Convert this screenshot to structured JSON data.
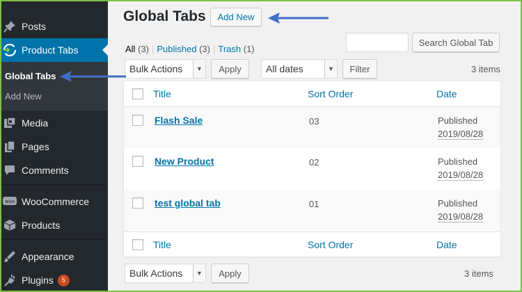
{
  "sidebar": {
    "items": [
      {
        "label": "Posts",
        "icon": "pin-icon"
      },
      {
        "label": "Product Tabs",
        "icon": "product-tabs-icon",
        "active": true
      },
      {
        "label": "Media",
        "icon": "media-icon"
      },
      {
        "label": "Pages",
        "icon": "pages-icon"
      },
      {
        "label": "Comments",
        "icon": "comments-icon"
      },
      {
        "label": "WooCommerce",
        "icon": "woocommerce-icon"
      },
      {
        "label": "Products",
        "icon": "products-icon"
      },
      {
        "label": "Appearance",
        "icon": "appearance-icon"
      },
      {
        "label": "Plugins",
        "icon": "plugins-icon",
        "badge": "5"
      }
    ],
    "submenu": [
      {
        "label": "Global Tabs",
        "current": true
      },
      {
        "label": "Add New"
      }
    ]
  },
  "header": {
    "title": "Global Tabs",
    "add_new_label": "Add New"
  },
  "filters": {
    "all_label": "All",
    "all_count": "(3)",
    "published_label": "Published",
    "published_count": "(3)",
    "trash_label": "Trash",
    "trash_count": "(1)",
    "separator": "|"
  },
  "search": {
    "value": "",
    "button_label": "Search Global Tab"
  },
  "tablenav_top": {
    "bulk_actions": "Bulk Actions",
    "apply_label": "Apply",
    "dates_value": "All dates",
    "filter_label": "Filter",
    "items_count": "3 items"
  },
  "table": {
    "columns": {
      "title": "Title",
      "sort_order": "Sort Order",
      "date": "Date"
    },
    "rows": [
      {
        "title": "Flash Sale",
        "sort_order": "03",
        "status": "Published",
        "date": "2019/08/28"
      },
      {
        "title": "New Product",
        "sort_order": "02",
        "status": "Published",
        "date": "2019/08/28"
      },
      {
        "title": "test global tab",
        "sort_order": "01",
        "status": "Published",
        "date": "2019/08/28"
      }
    ]
  },
  "tablenav_bottom": {
    "bulk_actions": "Bulk Actions",
    "apply_label": "Apply",
    "items_count": "3 items"
  },
  "colors": {
    "sidebar_bg": "#23282d",
    "active_bg": "#0073aa",
    "link": "#0073aa",
    "annotation_arrow": "#3d6fc4",
    "frame": "#7cc142",
    "badge": "#ca4a1f"
  }
}
